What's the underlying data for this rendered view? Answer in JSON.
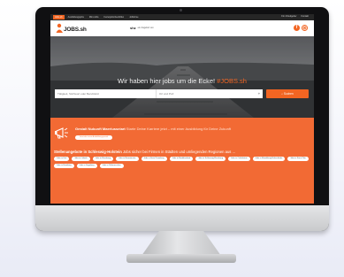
{
  "topbar": {
    "nav": [
      "Jobs.sh",
      "Ausbildungsjobs",
      "Mini-Jobs",
      "Ferienjobs/Aushilfen",
      "Jobbörse"
    ],
    "right": [
      "Für Arbeitgeber",
      "Kontakt"
    ]
  },
  "header": {
    "logo_text": "JOBS.sh",
    "partner_logo": "shz",
    "partner_text": "ein Angebot von"
  },
  "hero": {
    "title_main": "Wir haben hier jobs um die Ecke! ",
    "title_accent": "#JOBS.sh",
    "search_placeholder": "Tätigkeit, Stichwort oder Berufsfeld",
    "location_placeholder": "Ort und PLZ",
    "search_button": "Suchen"
  },
  "promo": {
    "title_bold": "Gestalt Nukunft Maerlusseiart",
    "title_light": " Starte Deine Karriere jetzt – mit einer Ausbildung für Deine Zukunft",
    "button": "Jetzt das neue Ausbildungsportal"
  },
  "jobs": {
    "heading_bold": "Stellenangebote in Schleswig-Holstein",
    "heading_rest": " Jobs sicher bei Firmen in Städten und umliegenden Regionen aus ...",
    "chips": [
      "Jobs in Kiel",
      "Jobs in Lübeck",
      "Jobs in Flensburg",
      "Jobs in Neumünster",
      "Jobs in Kreis Pinneberg",
      "Jobs in Nordfriesland",
      "Jobs in Schleswig-Flensburg",
      "Jobs in Ostholstein",
      "Jobs in Rendsburg-Eckernförde",
      "Jobs in Kreis Plön",
      "Jobs in Hamburg",
      "Jobs in Segeberg",
      "Jobs in Dithmarschen"
    ]
  },
  "colors": {
    "accent": "#f26522",
    "promo_bg": "#f26a34",
    "topbar": "#262626"
  },
  "icons": {
    "social": [
      "facebook-icon",
      "instagram-icon"
    ],
    "search": "location-pin-icon",
    "promo": "megaphone-icon"
  }
}
